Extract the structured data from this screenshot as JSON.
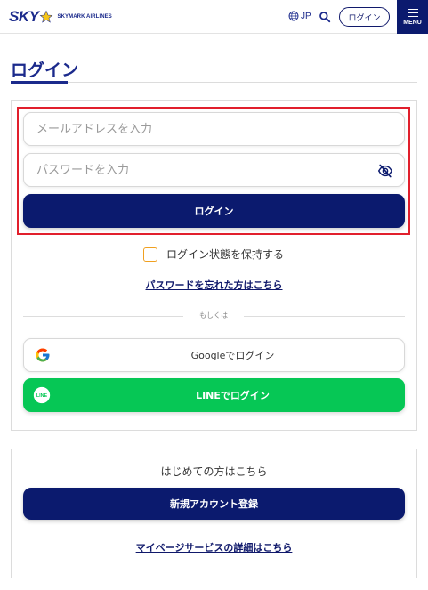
{
  "header": {
    "logo_text": "SKY",
    "logo_subtext": "SKYMARK AIRLINES",
    "language": "JP",
    "login_label": "ログイン",
    "menu_label": "MENU"
  },
  "page": {
    "title": "ログイン"
  },
  "login_form": {
    "email_placeholder": "メールアドレスを入力",
    "password_placeholder": "パスワードを入力",
    "submit_label": "ログイン",
    "remember_label": "ログイン状態を保持する",
    "remember_checked": false,
    "forgot_password_link": "パスワードを忘れた方はこちら",
    "divider_text": "もしくは",
    "google_label": "Googleでログイン",
    "line_label": "LINEでログイン",
    "line_icon_text": "LINE"
  },
  "new_account": {
    "heading": "はじめての方はこちら",
    "register_label": "新規アカウント登録",
    "mypage_link": "マイページサービスの詳細はこちら"
  },
  "colors": {
    "brand_navy": "#0b1a6e",
    "highlight_red": "#e11f2c",
    "line_green": "#06c755",
    "checkbox_orange": "#f0a020"
  },
  "icons": {
    "globe": "globe-icon",
    "search": "search-icon",
    "eye": "eye-slash-icon",
    "google": "google-icon",
    "line": "line-icon",
    "star": "star-icon",
    "menu": "hamburger-icon"
  }
}
